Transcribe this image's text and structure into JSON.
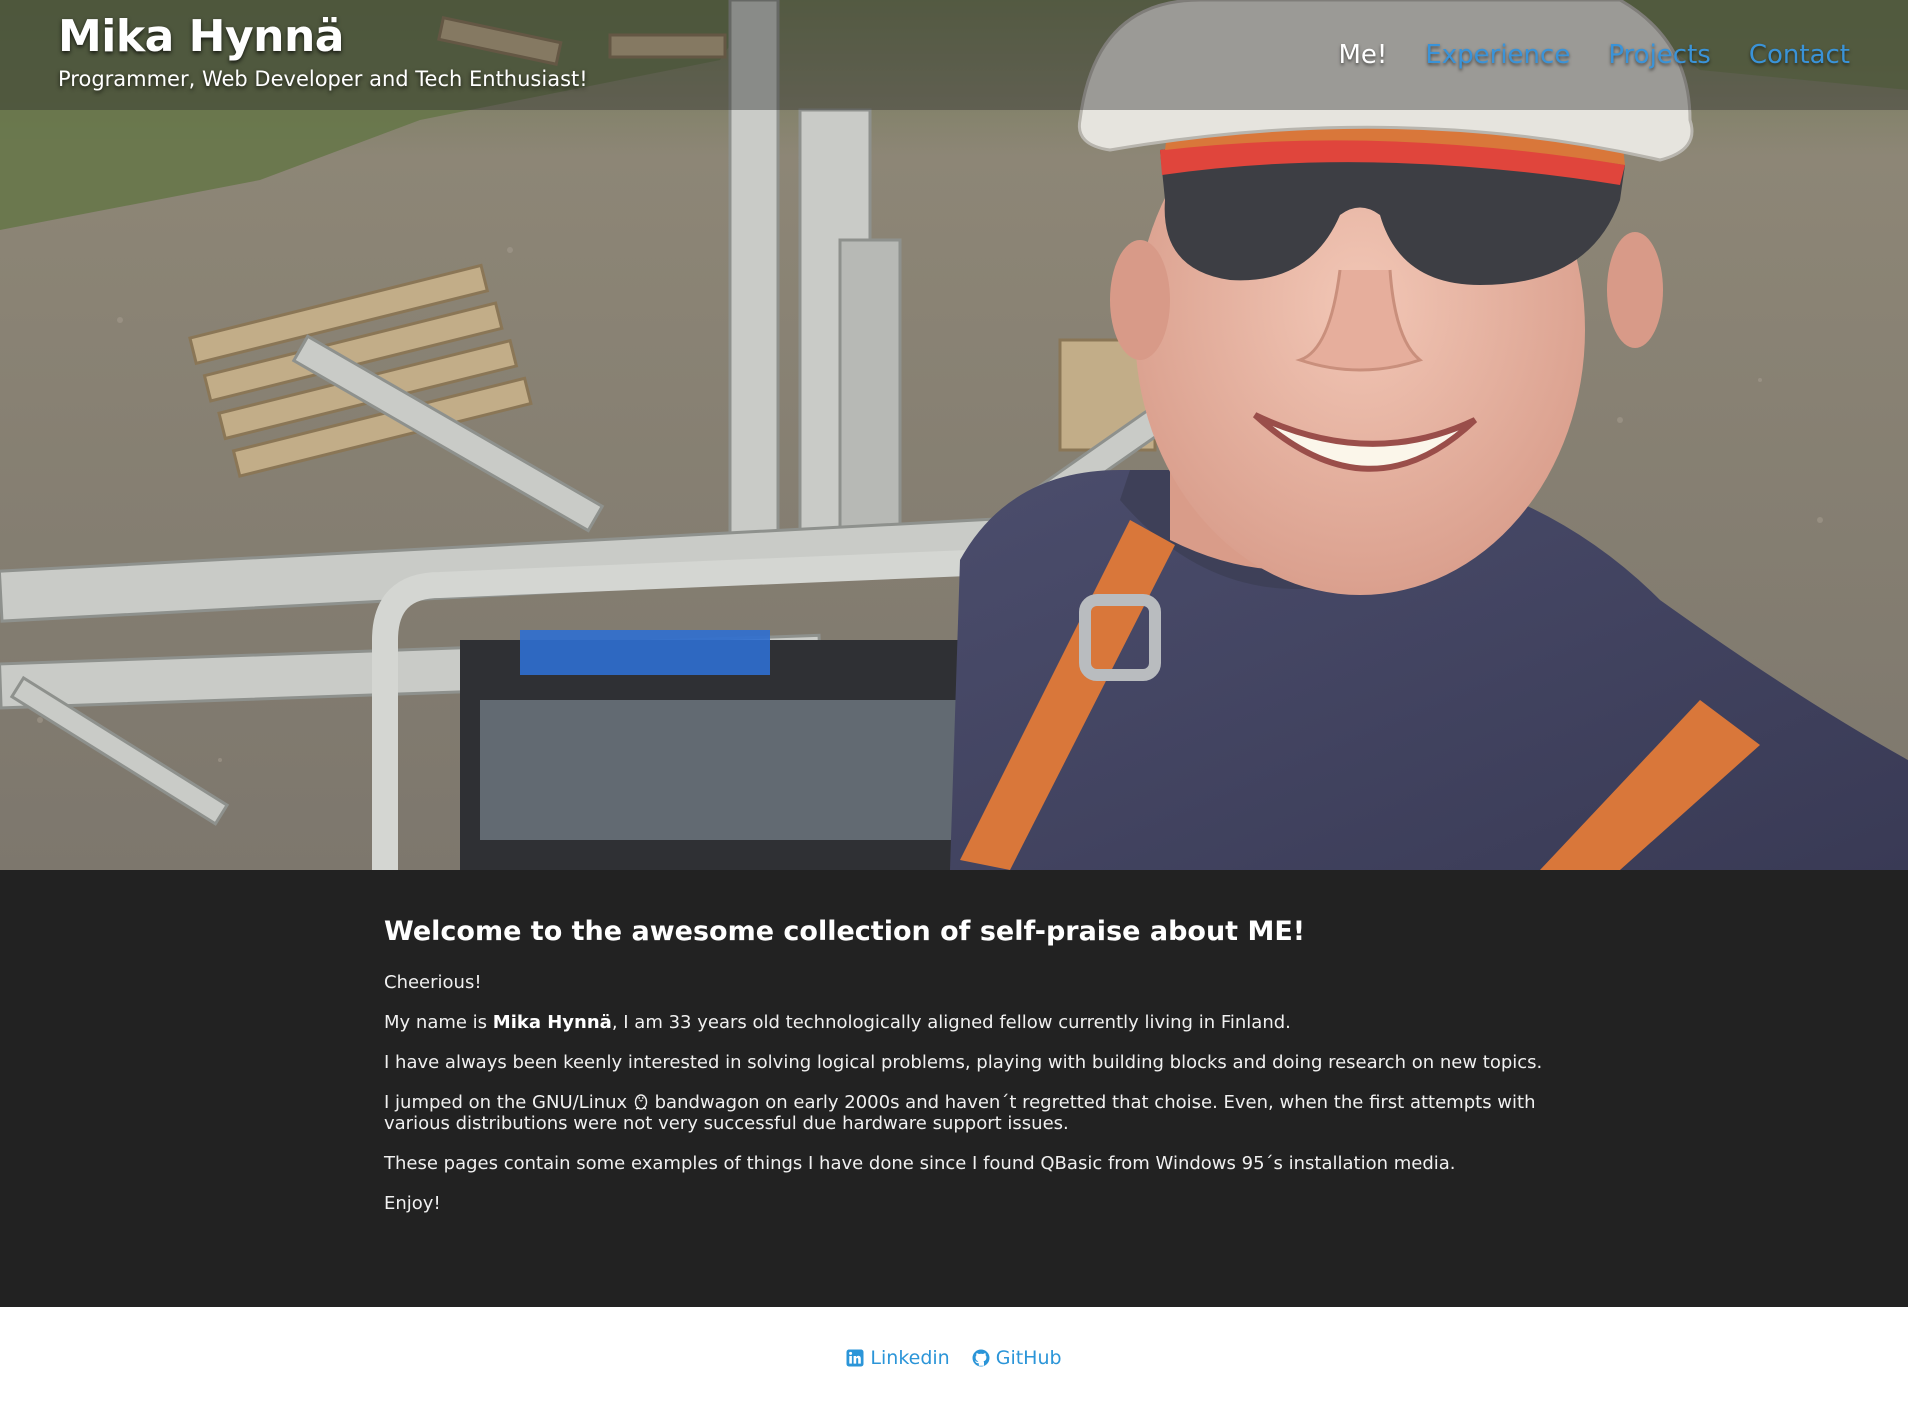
{
  "header": {
    "name": "Mika Hynnä",
    "tagline": "Programmer, Web Developer and Tech Enthusiast!"
  },
  "nav": {
    "items": [
      {
        "label": "Me!",
        "active": true
      },
      {
        "label": "Experience",
        "active": false
      },
      {
        "label": "Projects",
        "active": false
      },
      {
        "label": "Contact",
        "active": false
      }
    ]
  },
  "main": {
    "title": "Welcome to the awesome collection of self-praise about ME!",
    "greeting": "Cheerious!",
    "intro_before": "My name is ",
    "intro_name": "Mika Hynnä",
    "intro_after": ", I am 33 years old technologically aligned fellow currently living in Finland.",
    "interests": "I have always been keenly interested in solving logical problems, playing with building blocks and doing research on new topics.",
    "linux_before": "I jumped on the GNU/Linux ",
    "linux_after": " bandwagon on early 2000s and haven´t regretted that choise. Even, when the first attempts with various distributions were not very successful due hardware support issues.",
    "qbasic": "These pages contain some examples of things I have done since I found QBasic from Windows 95´s installation media.",
    "closing": "Enjoy!"
  },
  "footer": {
    "links": [
      {
        "label": "Linkedin",
        "icon": "linkedin-icon"
      },
      {
        "label": "GitHub",
        "icon": "github-icon"
      }
    ]
  },
  "colors": {
    "link_blue": "#3a93d8",
    "main_bg": "#222222",
    "footer_link": "#2b95d8"
  }
}
